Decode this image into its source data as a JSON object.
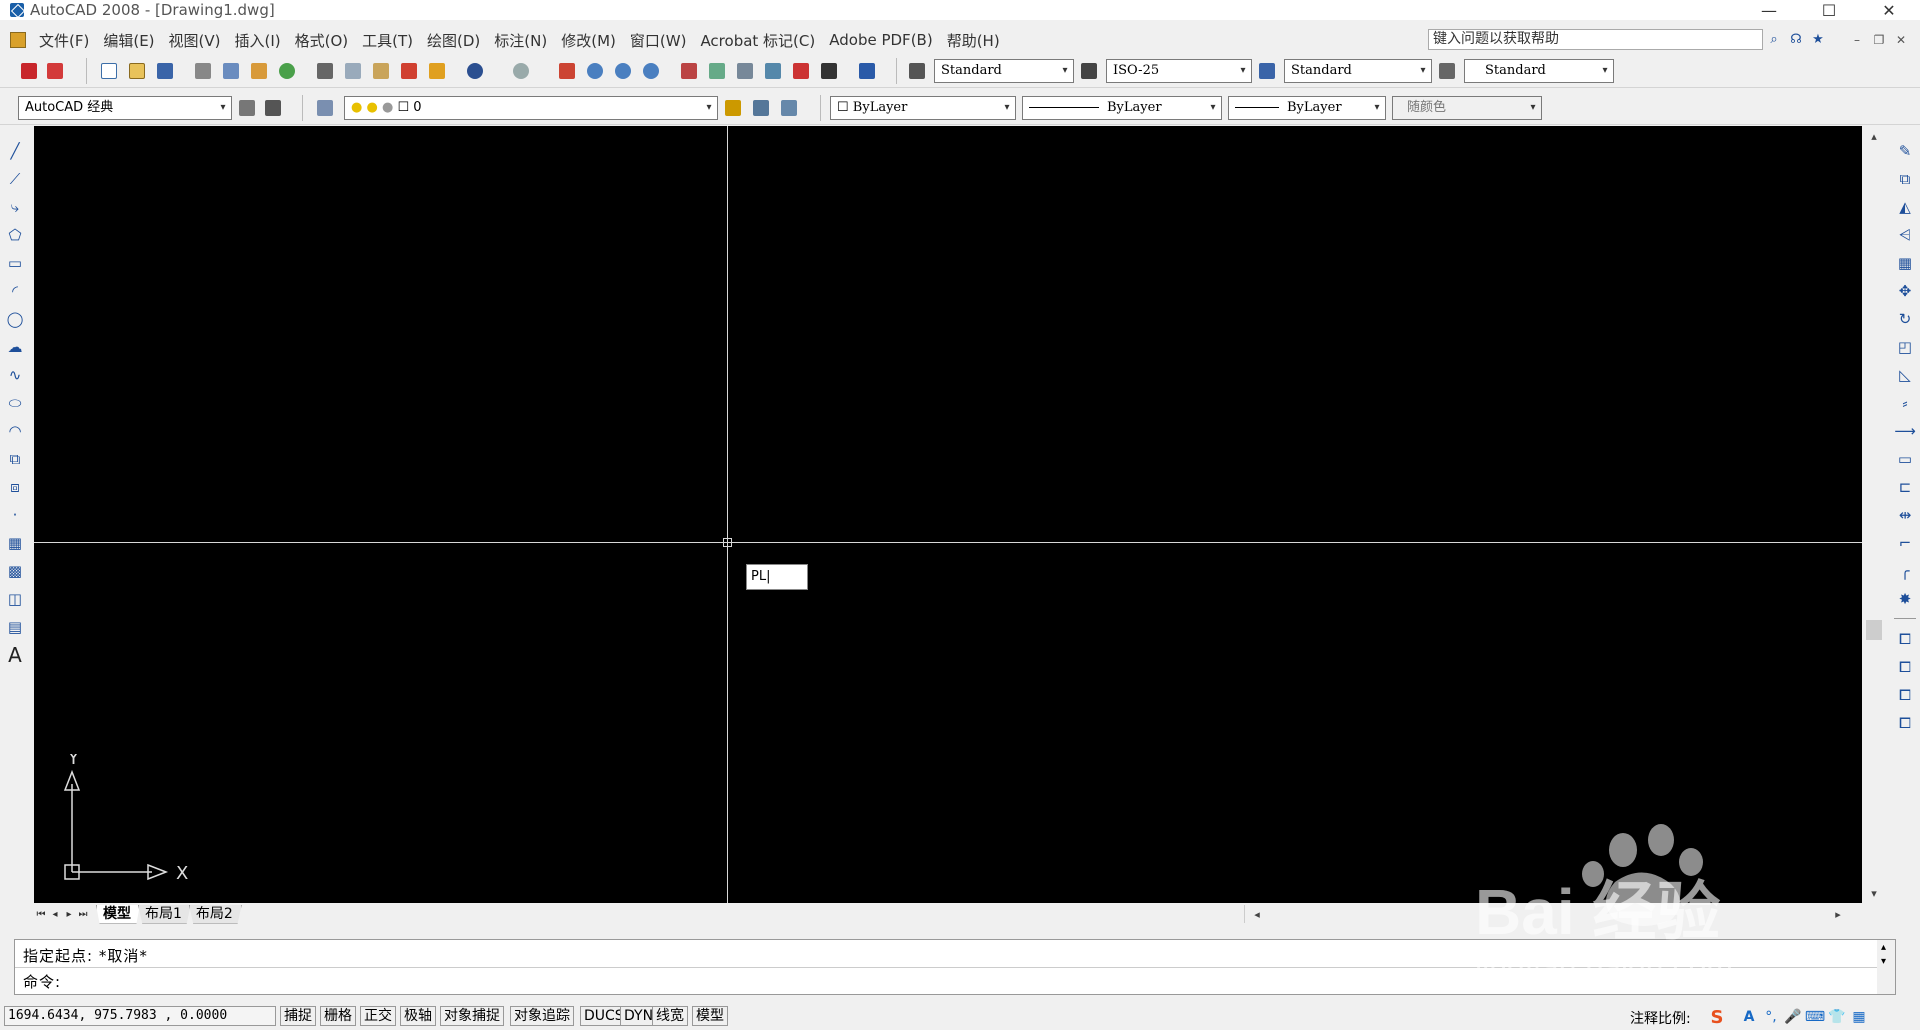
{
  "window": {
    "title": "AutoCAD 2008 - [Drawing1.dwg]",
    "minimize": "—",
    "maximize": "☐",
    "close": "✕"
  },
  "menu": {
    "items": [
      "文件(F)",
      "编辑(E)",
      "视图(V)",
      "插入(I)",
      "格式(O)",
      "工具(T)",
      "绘图(D)",
      "标注(N)",
      "修改(M)",
      "窗口(W)",
      "Acrobat 标记(C)",
      "Adobe PDF(B)",
      "帮助(H)"
    ],
    "help_placeholder": "键入问题以获取帮助"
  },
  "toolbar1": {
    "text_style": "Standard",
    "dim_style": "ISO-25",
    "table_style": "Standard",
    "mleader_style": "Standard"
  },
  "toolbar2": {
    "workspace": "AutoCAD 经典",
    "layer": "0",
    "color": "ByLayer",
    "linetype": "ByLayer",
    "lineweight": "ByLayer",
    "plot_style": "随颜色"
  },
  "canvas": {
    "dynamic_input": "PL|",
    "ucs_x": "X",
    "ucs_y": "Y",
    "background": "#000000",
    "crosshair_color": "#d8d8d8"
  },
  "tabs": [
    "模型",
    "布局1",
    "布局2"
  ],
  "command": {
    "line1": "指定起点: *取消*",
    "line2": "命令:"
  },
  "status": {
    "coords": "1694.6434, 975.7983 , 0.0000",
    "buttons": [
      "捕捉",
      "栅格",
      "正交",
      "极轴",
      "对象捕捉",
      "对象追踪",
      "DUCS",
      "DYN",
      "线宽",
      "模型"
    ],
    "annotation_scale_label": "注释比例:"
  },
  "watermark": {
    "logo_text": "Bai  经验",
    "url": "jingyan.baidu.com"
  }
}
